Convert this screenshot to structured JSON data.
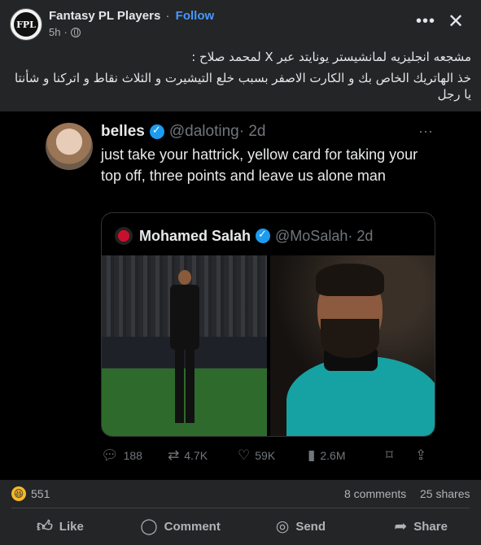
{
  "header": {
    "page_name": "Fantasy PL Players",
    "separator": "·",
    "follow_label": "Follow",
    "time": "5h",
    "more_icon": "more-horizontal-icon",
    "close_icon": "close-icon"
  },
  "caption": {
    "line1": "مشجعه انجليزيه لمانشيستر يونايتد عبر X لمحمد صلاح :",
    "line2": "خذ الهاتريك الخاص بك و الكارت الاصفر بسبب خلع التيشيرت و الثلاث نقاط و اتركنا و شأنتا يا رجل"
  },
  "tweet": {
    "name": "belles",
    "handle": "@daloting",
    "time": "· 2d",
    "more": "···",
    "text": "just take your hattrick, yellow card for taking your top off, three points and leave us alone man",
    "quote": {
      "name": "Mohamed Salah",
      "handle": "@MoSalah",
      "time": "· 2d"
    },
    "stats": {
      "replies": "188",
      "retweets": "4.7K",
      "likes": "59K",
      "views": "2.6M"
    }
  },
  "post_stats": {
    "reactions": "551",
    "comments": "8 comments",
    "shares": "25 shares"
  },
  "actions": {
    "like": "Like",
    "comment": "Comment",
    "send": "Send",
    "share": "Share"
  }
}
